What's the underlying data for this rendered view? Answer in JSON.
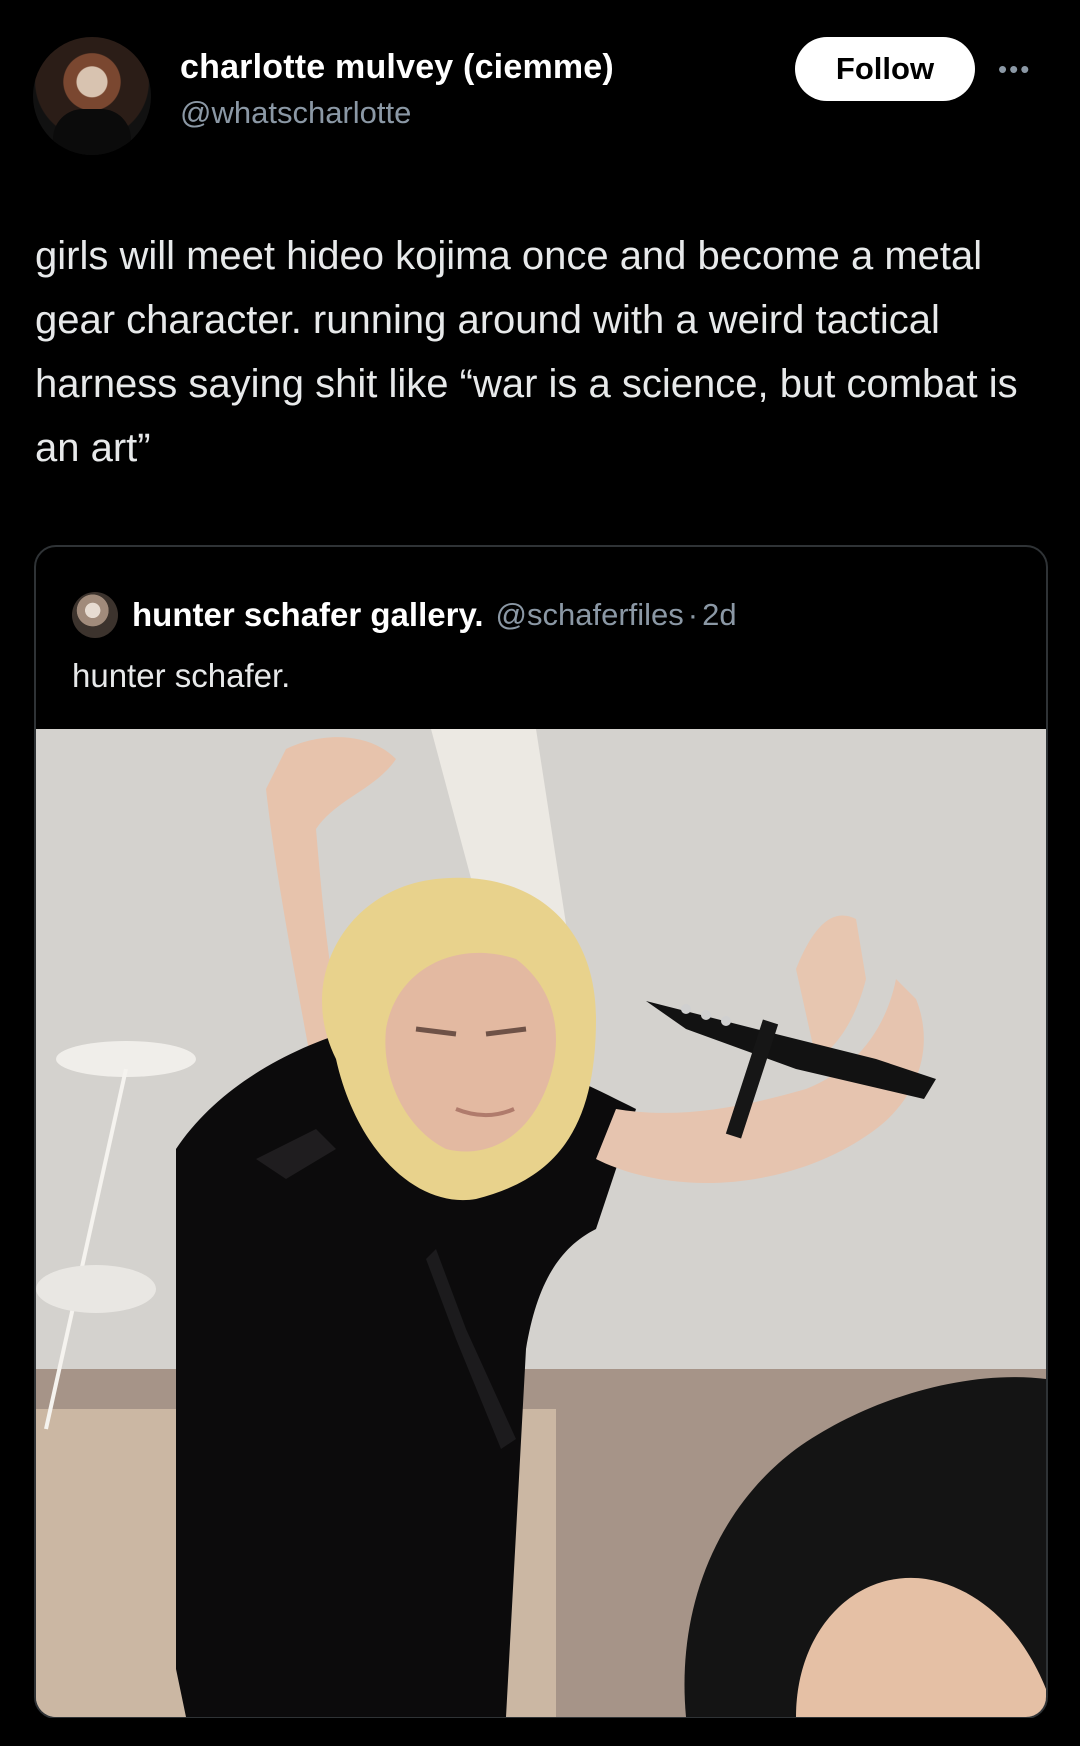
{
  "post": {
    "author": {
      "display_name": "charlotte mulvey (ciemme)",
      "handle": "@whatscharlotte"
    },
    "follow_label": "Follow",
    "more_icon": "more-horizontal-icon",
    "text": "girls will meet hideo kojima once and become a metal gear character. running around with a weird tactical harness saying shit like “war is a science, but combat is an art”"
  },
  "quoted_post": {
    "author": {
      "display_name": "hunter schafer gallery.",
      "handle": "@schaferfiles",
      "dot": "·",
      "time": "2d"
    },
    "text": "hunter schafer."
  },
  "colors": {
    "background": "#000000",
    "text_primary": "#e7e9ea",
    "text_secondary": "#8b98a5",
    "button_bg": "#ffffff",
    "border": "#2f3336"
  }
}
